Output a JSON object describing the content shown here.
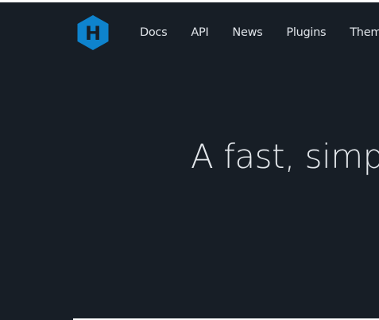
{
  "header": {
    "logo": {
      "icon": "hexo-hexagon-logo-icon",
      "letter": "H",
      "color": "#0e83cd"
    },
    "nav": [
      {
        "label": "Docs"
      },
      {
        "label": "API"
      },
      {
        "label": "News"
      },
      {
        "label": "Plugins"
      },
      {
        "label": "Themes"
      }
    ]
  },
  "hero": {
    "headline": "A fast, simple & powerful blog framework",
    "background_color": "#171e26"
  }
}
